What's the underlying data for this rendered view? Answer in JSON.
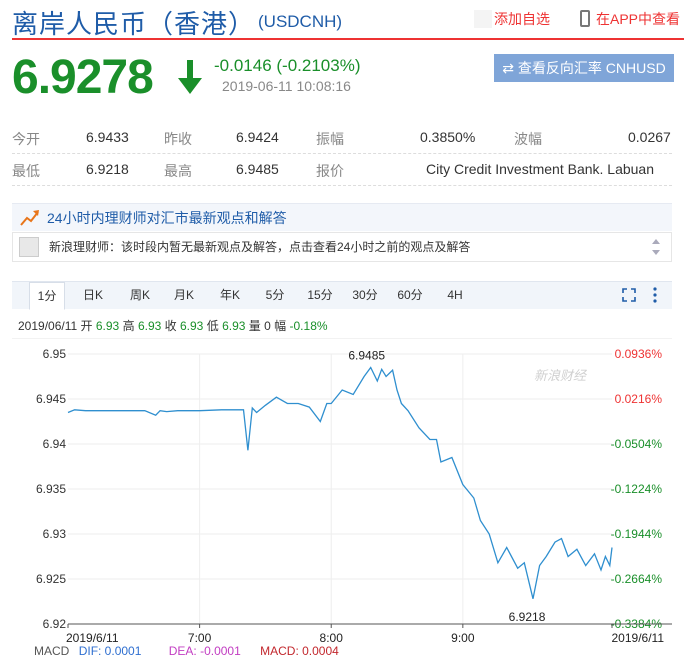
{
  "header": {
    "title": "离岸人民币（香港）",
    "code": "(USDCNH)",
    "add_favorite": "添加自选",
    "view_app": "在APP中查看"
  },
  "quote": {
    "price": "6.9278",
    "change": "-0.0146 (-0.2103%)",
    "timestamp": "2019-06-11 10:08:16",
    "reverse_button": "⇄ 查看反向汇率 CNHUSD"
  },
  "info": {
    "row1": [
      {
        "label": "今开",
        "value": "6.9433"
      },
      {
        "label": "昨收",
        "value": "6.9424"
      },
      {
        "label": "振幅",
        "value": "0.3850%"
      },
      {
        "label": "波幅",
        "value": "0.0267"
      }
    ],
    "row2": [
      {
        "label": "最低",
        "value": "6.9218"
      },
      {
        "label": "最高",
        "value": "6.9485"
      },
      {
        "label": "报价",
        "value": "City Credit Investment Bank. Labuan"
      }
    ]
  },
  "advisor": {
    "title": "24小时内理财师对汇市最新观点和解答",
    "body": "新浪理财师：该时段内暂无最新观点及解答，点击查看24小时之前的观点及解答"
  },
  "tabs": [
    "1分",
    "日K",
    "周K",
    "月K",
    "年K",
    "5分",
    "15分",
    "30分",
    "60分",
    "4H"
  ],
  "active_tab": "1分",
  "ohlc": {
    "date": "2019/06/11",
    "open_label": "开",
    "open": "6.93",
    "high_label": "高",
    "high": "6.93",
    "close_label": "收",
    "close": "6.93",
    "low_label": "低",
    "low": "6.93",
    "vol_label": "量",
    "vol": "0",
    "amp_label": "幅",
    "amp": "-0.18%"
  },
  "macd": {
    "label": "MACD",
    "dif": "DIF: 0.0001",
    "dea": "DEA: -0.0001",
    "macd": "MACD: 0.0004"
  },
  "colors": {
    "up": "#e33",
    "down": "#1a8f2a",
    "line": "#2f8fcf",
    "brand": "#1f5ca8"
  },
  "chart_data": {
    "type": "line",
    "watermark": "新浪财经",
    "ylim": [
      6.92,
      6.95
    ],
    "y_ticks": [
      "6.95",
      "6.945",
      "6.94",
      "6.935",
      "6.93",
      "6.925",
      "6.92"
    ],
    "y_ticks_right": [
      "0.0936%",
      "0.0216%",
      "-0.0504%",
      "-0.1224%",
      "-0.1944%",
      "-0.2664%",
      "-0.3384%"
    ],
    "x_ticks": [
      "2019/6/11",
      "7:00",
      "8:00",
      "9:00",
      "2019/6/11"
    ],
    "x_tick_minutes": [
      0,
      60,
      120,
      180,
      248
    ],
    "x_range_minutes": [
      0,
      248
    ],
    "high_label": "6.9485",
    "low_label": "6.9218",
    "series": [
      {
        "minutes": [
          0,
          3,
          8,
          20,
          35,
          40,
          42,
          45,
          50,
          60,
          70,
          80,
          82,
          84,
          86,
          90,
          95,
          100,
          105,
          110,
          115,
          118,
          120,
          125,
          130,
          135,
          138,
          141,
          143,
          145,
          148,
          150,
          152,
          155,
          160,
          165,
          168,
          170,
          175,
          180,
          185,
          188,
          192,
          196,
          200,
          205,
          208,
          212,
          215,
          218,
          222,
          225,
          228,
          232,
          236,
          240,
          243,
          245,
          247,
          248
        ],
        "values": [
          6.9435,
          6.9438,
          6.9437,
          6.9437,
          6.9437,
          6.9432,
          6.9437,
          6.9436,
          6.9437,
          6.9437,
          6.9438,
          6.9438,
          6.9393,
          6.944,
          6.9435,
          6.9443,
          6.9452,
          6.9445,
          6.9445,
          6.9441,
          6.9425,
          6.9445,
          6.9445,
          6.946,
          6.9455,
          6.9475,
          6.9485,
          6.947,
          6.9483,
          6.9475,
          6.9482,
          6.946,
          6.9445,
          6.9437,
          6.9418,
          6.9405,
          6.9405,
          6.938,
          6.9385,
          6.9355,
          6.934,
          6.9315,
          6.93,
          6.9268,
          6.9285,
          6.9262,
          6.9268,
          6.9228,
          6.9265,
          6.9275,
          6.9291,
          6.9295,
          6.9275,
          6.9283,
          6.9265,
          6.9278,
          6.926,
          6.9275,
          6.9265,
          6.9285
        ]
      }
    ]
  }
}
